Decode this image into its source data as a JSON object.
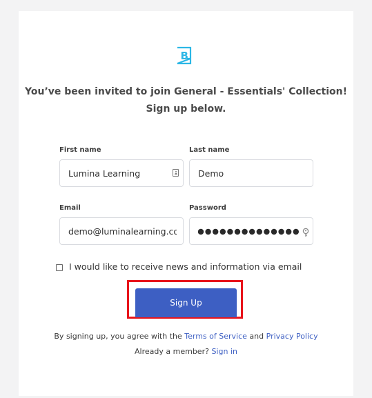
{
  "invite": {
    "line1": "You’ve been invited to join General - Essentials' Collection!",
    "line2": "Sign up below."
  },
  "form": {
    "first_name": {
      "label": "First name",
      "value": "Lumina Learning"
    },
    "last_name": {
      "label": "Last name",
      "value": "Demo"
    },
    "email": {
      "label": "Email",
      "value": "demo@luminalearning.co"
    },
    "password": {
      "label": "Password",
      "masked_length": 14
    },
    "newsletter": {
      "label": "I would like to receive news and information via email",
      "checked": false
    },
    "submit_label": "Sign Up"
  },
  "legal": {
    "prefix": "By signing up, you agree with the ",
    "terms": "Terms of Service",
    "and": " and ",
    "privacy": "Privacy Policy",
    "member_prompt": "Already a member? ",
    "sign_in": "Sign in"
  },
  "colors": {
    "brand": "#3d5fc3",
    "logo": "#2cb7e6",
    "highlight": "#e8141b"
  },
  "icons": {
    "logo": "brand-b-logo-icon",
    "contact_card": "contact-card-icon",
    "password_key": "key-icon"
  }
}
